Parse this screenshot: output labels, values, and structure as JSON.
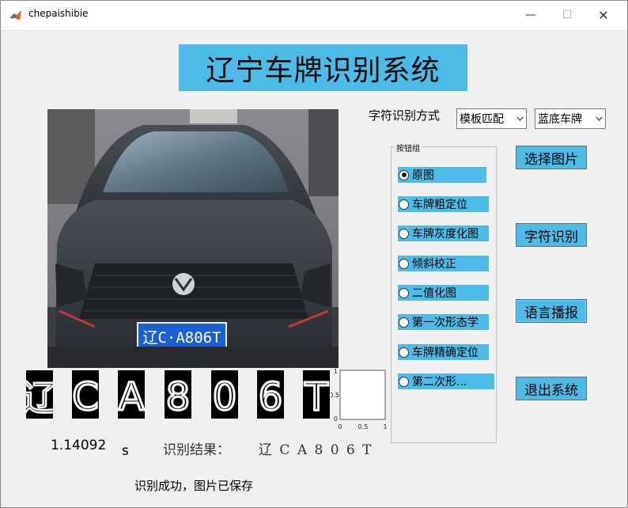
{
  "window": {
    "title": "chepaishibie",
    "minimize_glyph": "—",
    "maximize_glyph": "☐",
    "close_glyph": "✕"
  },
  "header": {
    "title": "辽宁车牌识别系统"
  },
  "method": {
    "label": "字符识别方式",
    "method_value": "模板匹配",
    "plate_value": "蓝底车牌"
  },
  "main_image": {
    "plate_text": "辽C·A806T"
  },
  "segmented_chars": [
    "辽",
    "C",
    "A",
    "8",
    "0",
    "6",
    "T"
  ],
  "mini_plot": {
    "y_ticks": [
      "1",
      "0.5",
      "0"
    ],
    "x_ticks": [
      "0",
      "0.5",
      "1"
    ]
  },
  "button_group": {
    "label": "按钮组",
    "options": [
      {
        "label": "原图",
        "selected": true
      },
      {
        "label": "车牌粗定位",
        "selected": false
      },
      {
        "label": "车牌灰度化图",
        "selected": false
      },
      {
        "label": "倾斜校正",
        "selected": false
      },
      {
        "label": "二值化图",
        "selected": false
      },
      {
        "label": "第一次形态学",
        "selected": false
      },
      {
        "label": "车牌精确定位",
        "selected": false
      },
      {
        "label": "第二次形...",
        "selected": false
      }
    ]
  },
  "buttons": {
    "select_image": "选择图片",
    "recognize": "字符识别",
    "speak": "语言播报",
    "exit": "退出系统"
  },
  "results": {
    "elapsed": "1.14092",
    "unit": "s",
    "result_label": "识别结果：",
    "result_value": "辽 C A 8 0 6 T",
    "status": "识别成功，图片已保存"
  },
  "colors": {
    "accent": "#4dbbe8",
    "background": "#f0f0f0",
    "plate_blue": "#1a5fd6"
  }
}
